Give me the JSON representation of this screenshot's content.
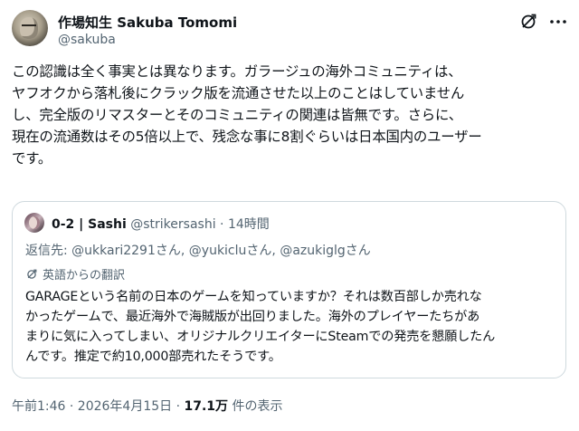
{
  "author": {
    "display_name": "作場知生 Sakuba Tomomi",
    "handle": "@sakuba"
  },
  "tweet": {
    "lines": [
      "この認識は全く事実とは異なります。ガラージュの海外コミュニティは、",
      "ヤフオクから落札後にクラック版を流通させた以上のことはしていません",
      "し、完全版のリマスターとそのコミュニティの関連は皆無です。さらに、",
      "現在の流通数はその5倍以上で、残念な事に8割ぐらいは日本国内のユーザー",
      "です。"
    ]
  },
  "quote": {
    "display_name": "0-2 | Sashi",
    "handle": "@strikersashi",
    "separator": "·",
    "time": "14時間",
    "reply_prefix": "返信先: ",
    "mentions": [
      "@ukkari2291さん",
      "@yukicluさん",
      "@azukiglgさん"
    ],
    "translated_label": "英語からの翻訳",
    "lines": [
      "GARAGEという名前の日本のゲームを知っていますか？それは数百部しか売れな",
      "かったゲームで、最近海外で海賊版が出回りました。海外のプレイヤーたちがあ",
      "まりに気に入ってしまい、オリジナルクリエイターにSteamでの発売を懇願したん",
      "んです。推定で約10,000部売れたそうです。"
    ]
  },
  "meta": {
    "datetime": "午前1:46 · 2026年4月15日 · ",
    "views_count": "17.1万",
    "views_label": " 件の表示"
  },
  "icons": {
    "translate": "translate-icon",
    "more": "more-icon"
  },
  "colors": {
    "text": "#0f1419",
    "secondary": "#536471",
    "border": "#cfd9de"
  }
}
